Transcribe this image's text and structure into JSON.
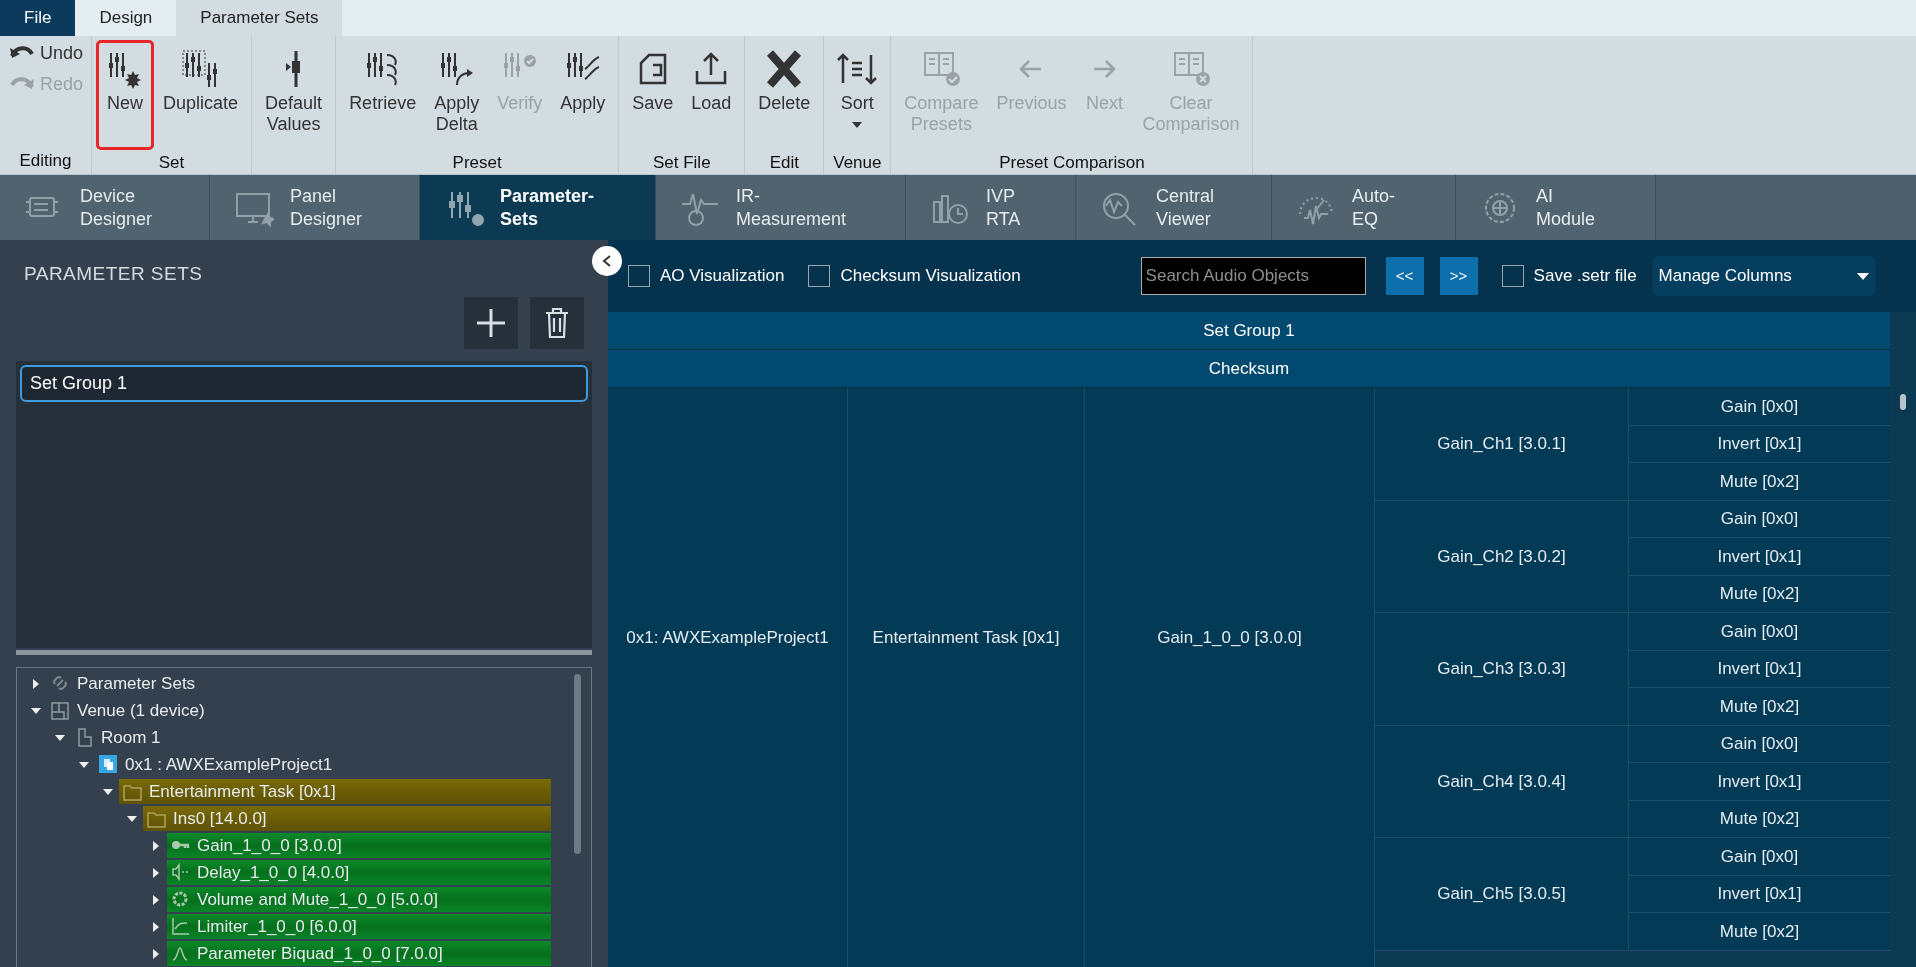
{
  "menu_tabs": [
    {
      "label": "File",
      "kind": "file"
    },
    {
      "label": "Design",
      "kind": "tab",
      "selected": false
    },
    {
      "label": "Parameter Sets",
      "kind": "tab",
      "selected": true
    }
  ],
  "ribbon": [
    {
      "label": "Editing",
      "kind": "small",
      "buttons": [
        {
          "label": "Undo",
          "kind": "undo",
          "disabled": false,
          "highlighted": false
        },
        {
          "label": "Redo",
          "kind": "redo",
          "disabled": true,
          "highlighted": false
        }
      ]
    },
    {
      "label": "Set",
      "kind": "large",
      "buttons": [
        {
          "label": "New",
          "kind": "new",
          "disabled": false,
          "highlighted": true
        },
        {
          "label": "Duplicate",
          "kind": "duplicate",
          "disabled": false,
          "highlighted": false
        }
      ]
    },
    {
      "kind": "large",
      "buttons": [
        {
          "label": "Default Values",
          "kind": "default",
          "disabled": false,
          "highlighted": false
        }
      ]
    },
    {
      "label": "Preset",
      "kind": "large",
      "buttons": [
        {
          "label": "Retrieve",
          "kind": "retrieve",
          "disabled": false,
          "highlighted": false
        },
        {
          "label": "Apply Delta",
          "kind": "delta",
          "disabled": false,
          "highlighted": false
        },
        {
          "label": "Verify",
          "kind": "verify",
          "disabled": true,
          "highlighted": false
        },
        {
          "label": "Apply",
          "kind": "apply",
          "disabled": false,
          "highlighted": false
        }
      ]
    },
    {
      "label": "Set File",
      "kind": "large",
      "buttons": [
        {
          "label": "Save",
          "kind": "save",
          "disabled": false,
          "highlighted": false
        },
        {
          "label": "Load",
          "kind": "load",
          "disabled": false,
          "highlighted": false
        }
      ]
    },
    {
      "label": "Edit",
      "kind": "large",
      "buttons": [
        {
          "label": "Delete",
          "kind": "delete",
          "disabled": false,
          "highlighted": false
        }
      ]
    },
    {
      "label": "Venue",
      "kind": "large",
      "buttons": [
        {
          "label": "Sort",
          "kind": "sort",
          "disabled": false,
          "highlighted": false,
          "dropdown": true
        }
      ]
    },
    {
      "label": "Preset Comparison",
      "kind": "large",
      "buttons": [
        {
          "label": "Compare Presets",
          "kind": "compare",
          "disabled": true,
          "highlighted": false
        },
        {
          "label": "Previous",
          "kind": "prev",
          "disabled": true,
          "highlighted": false
        },
        {
          "label": "Next",
          "kind": "next",
          "disabled": true,
          "highlighted": false
        },
        {
          "label": "Clear Comparison",
          "kind": "clear",
          "disabled": true,
          "highlighted": false
        }
      ]
    }
  ],
  "module_tabs": [
    {
      "label": "Device\nDesigner",
      "kind": "device",
      "selected": false
    },
    {
      "label": "Panel\nDesigner",
      "kind": "panel",
      "selected": false
    },
    {
      "label": "Parameter-\nSets",
      "kind": "sets",
      "selected": true
    },
    {
      "label": "IR-\nMeasurement",
      "kind": "ir",
      "selected": false
    },
    {
      "label": "IVP\nRTA",
      "kind": "rta",
      "selected": false
    },
    {
      "label": "Central\nViewer",
      "kind": "viewer",
      "selected": false
    },
    {
      "label": "Auto-\nEQ",
      "kind": "eq",
      "selected": false
    },
    {
      "label": "AI\nModule",
      "kind": "ai",
      "selected": false
    }
  ],
  "left_panel": {
    "title": "PARAMETER SETS",
    "set_groups": [
      {
        "label": "Set Group 1",
        "selected": true
      }
    ],
    "tree": [
      {
        "label": "Parameter Sets",
        "kind": "link",
        "expanded": false
      },
      {
        "label": "Venue (1 device)",
        "kind": "venue",
        "expanded": true,
        "children": [
          {
            "label": "Room 1",
            "kind": "room",
            "expanded": true,
            "children": [
              {
                "label": "0x1 : AWXExampleProject1",
                "kind": "device",
                "expanded": true,
                "children": [
                  {
                    "label": "Entertainment Task [0x1]",
                    "kind": "folder",
                    "expanded": true,
                    "children": [
                      {
                        "label": "Ins0 [14.0.0]",
                        "kind": "folder",
                        "expanded": true,
                        "children": [
                          {
                            "label": "Gain_1_0_0 [3.0.0]",
                            "kind": "key",
                            "expanded": false
                          },
                          {
                            "label": "Delay_1_0_0 [4.0.0]",
                            "kind": "speaker",
                            "expanded": false
                          },
                          {
                            "label": "Volume and Mute_1_0_0 [5.0.0]",
                            "kind": "gear",
                            "expanded": false
                          },
                          {
                            "label": "Limiter_1_0_0 [6.0.0]",
                            "kind": "graph",
                            "expanded": false
                          },
                          {
                            "label": "Parameter Biquad_1_0_0 [7.0.0]",
                            "kind": "filter",
                            "expanded": false
                          }
                        ]
                      }
                    ]
                  }
                ]
              }
            ]
          }
        ]
      }
    ]
  },
  "toolbar": {
    "checkboxes": [
      {
        "label": "AO Visualization",
        "checked": false
      },
      {
        "label": "Checksum Visualization",
        "checked": false
      }
    ],
    "search": {
      "placeholder": "Search Audio Objects"
    },
    "prev": "<<",
    "next": ">>",
    "save_checkbox": {
      "label": "Save .setr file",
      "checked": false
    },
    "manage": "Manage Columns"
  },
  "table": {
    "headers": [
      "Set Group 1",
      "Checksum"
    ],
    "device": "0x1: AWXExampleProject1",
    "task": "Entertainment Task [0x1]",
    "block": "Gain_1_0_0 [3.0.0]",
    "channels": [
      {
        "name": "Gain_Ch1 [3.0.1]",
        "params": [
          "Gain [0x0]",
          "Invert [0x1]",
          "Mute [0x2]"
        ]
      },
      {
        "name": "Gain_Ch2 [3.0.2]",
        "params": [
          "Gain [0x0]",
          "Invert [0x1]",
          "Mute [0x2]"
        ]
      },
      {
        "name": "Gain_Ch3 [3.0.3]",
        "params": [
          "Gain [0x0]",
          "Invert [0x1]",
          "Mute [0x2]"
        ]
      },
      {
        "name": "Gain_Ch4 [3.0.4]",
        "params": [
          "Gain [0x0]",
          "Invert [0x1]",
          "Mute [0x2]"
        ]
      },
      {
        "name": "Gain_Ch5 [3.0.5]",
        "params": [
          "Gain [0x0]",
          "Invert [0x1]",
          "Mute [0x2]"
        ]
      }
    ]
  }
}
